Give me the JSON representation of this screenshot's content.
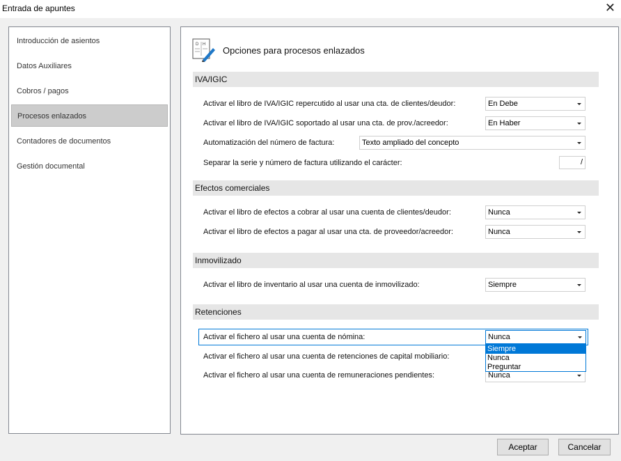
{
  "window": {
    "title": "Entrada de apuntes",
    "close_glyph": "✕"
  },
  "sidebar": {
    "items": [
      {
        "label": "Introducción de asientos"
      },
      {
        "label": "Datos Auxiliares"
      },
      {
        "label": "Cobros / pagos"
      },
      {
        "label": "Procesos enlazados"
      },
      {
        "label": "Contadores de documentos"
      },
      {
        "label": "Gestión documental"
      }
    ],
    "selected": "Procesos enlazados"
  },
  "header": {
    "title": "Opciones para procesos enlazados",
    "icon": "edit-document-icon",
    "icon_letters": [
      "D",
      "H"
    ]
  },
  "sections": {
    "iva": {
      "title": "IVA/IGIC",
      "rows": [
        {
          "label": "Activar el libro de IVA/IGIC repercutido al usar una cta. de clientes/deudor:",
          "value": "En Debe"
        },
        {
          "label": "Activar el libro de IVA/IGIC soportado al usar una cta. de prov./acreedor:",
          "value": "En Haber"
        },
        {
          "label": "Automatización del número de factura:",
          "value": "Texto ampliado del concepto"
        },
        {
          "label": "Separar la serie y número de factura utilizando el carácter:",
          "value": "/"
        }
      ]
    },
    "efectos": {
      "title": "Efectos comerciales",
      "rows": [
        {
          "label": "Activar el libro de efectos a cobrar al usar una cuenta de clientes/deudor:",
          "value": "Nunca"
        },
        {
          "label": "Activar el libro de efectos a pagar al usar una cta. de proveedor/acreedor:",
          "value": "Nunca"
        }
      ]
    },
    "inmovilizado": {
      "title": "Inmovilizado",
      "rows": [
        {
          "label": "Activar el libro de inventario al usar una cuenta de inmovilizado:",
          "value": "Siempre"
        }
      ]
    },
    "retenciones": {
      "title": "Retenciones",
      "rows": [
        {
          "label": "Activar el fichero al usar una cuenta de nómina:",
          "value": "Nunca"
        },
        {
          "label": "Activar el fichero al usar una cuenta de retenciones de capital mobiliario:",
          "value": ""
        },
        {
          "label": "Activar el fichero al usar una cuenta de remuneraciones pendientes:",
          "value": "Nunca"
        }
      ]
    }
  },
  "dropdown": {
    "options": [
      "Siempre",
      "Nunca",
      "Preguntar"
    ],
    "highlighted": "Siempre"
  },
  "buttons": {
    "accept": "Aceptar",
    "cancel": "Cancelar"
  },
  "colors": {
    "accent": "#0078d7",
    "section_bg": "#e6e6e6",
    "selected_bg": "#cccccc"
  }
}
